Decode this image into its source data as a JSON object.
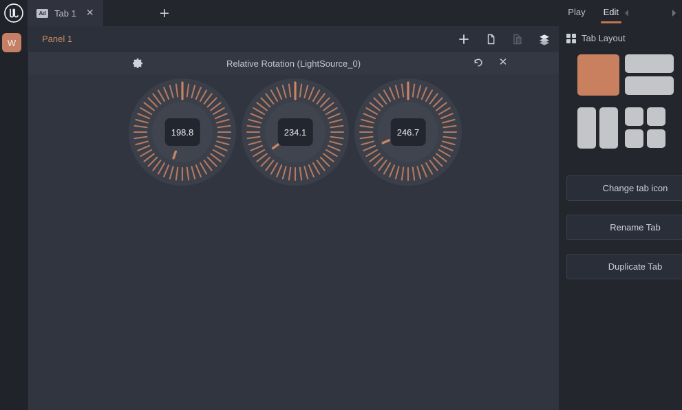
{
  "colors": {
    "accent": "#c4754f",
    "accent_light": "#c98a63",
    "swatch_selected": "#c9805f",
    "topbar_bg": "#24262e",
    "panel_bg": "#31353f",
    "tick": "#c98463"
  },
  "rail": {
    "logo_icon": "unreal-engine-logo",
    "badge_label": "W"
  },
  "topbar": {
    "tabs": [
      {
        "badge": "Ad",
        "label": "Tab 1",
        "close_icon": "close-icon",
        "active": true
      }
    ],
    "add_tab_icon": "plus-icon",
    "modes": [
      {
        "label": "Play",
        "active": false
      },
      {
        "label": "Edit",
        "active": true
      }
    ],
    "nav_prev_icon": "chevron-left-icon",
    "nav_next_icon": "chevron-right-icon"
  },
  "panel": {
    "title": "Panel 1",
    "tools": [
      {
        "name": "add-widget-button",
        "icon": "plus-icon",
        "enabled": true
      },
      {
        "name": "copy-button",
        "icon": "copy-icon",
        "enabled": true
      },
      {
        "name": "paste-button",
        "icon": "paste-icon",
        "enabled": false
      },
      {
        "name": "layers-button",
        "icon": "layers-icon",
        "enabled": true
      }
    ]
  },
  "widget": {
    "title": "Relative Rotation (LightSource_0)",
    "settings_icon": "gear-icon",
    "reset_icon": "reset-icon",
    "close_icon": "close-icon",
    "dials": [
      {
        "name": "dial-roll",
        "value": "198.8",
        "angle": 198.8
      },
      {
        "name": "dial-pitch",
        "value": "234.1",
        "angle": 234.1
      },
      {
        "name": "dial-yaw",
        "value": "246.7",
        "angle": 246.7
      }
    ]
  },
  "sidebar": {
    "header": {
      "label": "Tab Layout",
      "icon": "grid-icon"
    },
    "layouts": [
      {
        "name": "layout-single",
        "cells": 1,
        "selected": true
      },
      {
        "name": "layout-two-rows",
        "cells": 2,
        "selected": false
      },
      {
        "name": "layout-two-columns",
        "cells": 2,
        "selected": false
      },
      {
        "name": "layout-quad",
        "cells": 4,
        "selected": false
      }
    ],
    "buttons": [
      {
        "name": "change-tab-icon-button",
        "label": "Change tab icon"
      },
      {
        "name": "rename-tab-button",
        "label": "Rename Tab"
      },
      {
        "name": "duplicate-tab-button",
        "label": "Duplicate Tab"
      }
    ]
  }
}
